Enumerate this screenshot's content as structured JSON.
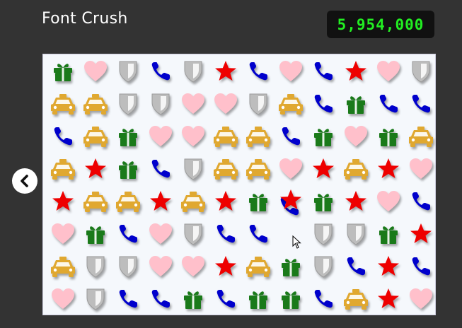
{
  "app": {
    "title": "Font Crush",
    "score": "5,954,000"
  },
  "nav": {
    "back_icon": "chevron-left-icon"
  },
  "colors": {
    "gift": "#1a7a1a",
    "heart": "#ffc0cb",
    "shield": "#bdbdbd",
    "phone": "#0000cc",
    "star": "#ee0000",
    "taxi": "#e0a830"
  },
  "board": {
    "rows": [
      [
        "gift",
        "heart",
        "shield",
        "phone",
        "shield",
        "star",
        "phone",
        "heart",
        "phone",
        "star",
        "heart",
        "shield"
      ],
      [
        "taxi",
        "taxi",
        "shield",
        "shield",
        "heart",
        "heart",
        "shield",
        "taxi",
        "phone",
        "gift",
        "phone",
        "phone"
      ],
      [
        "phone",
        "taxi",
        "gift",
        "heart",
        "heart",
        "taxi",
        "taxi",
        "phone",
        "gift",
        "heart",
        "gift",
        "taxi"
      ],
      [
        "taxi",
        "star",
        "gift",
        "phone",
        "shield",
        "taxi",
        "taxi",
        "heart",
        "star",
        "taxi",
        "star",
        "heart"
      ],
      [
        "star",
        "taxi",
        "taxi",
        "star",
        "taxi",
        "star",
        "gift",
        "star+phone",
        "gift",
        "star",
        "heart",
        "phone"
      ],
      [
        "heart",
        "gift",
        "phone",
        "heart",
        "shield",
        "phone",
        "phone",
        "empty",
        "shield",
        "shield",
        "gift",
        "star"
      ],
      [
        "taxi",
        "shield",
        "shield",
        "heart",
        "heart",
        "star",
        "taxi",
        "gift",
        "shield",
        "phone",
        "star",
        "phone"
      ],
      [
        "heart",
        "shield",
        "phone",
        "phone",
        "gift",
        "phone",
        "gift",
        "gift",
        "phone",
        "taxi",
        "star",
        "heart"
      ]
    ]
  }
}
